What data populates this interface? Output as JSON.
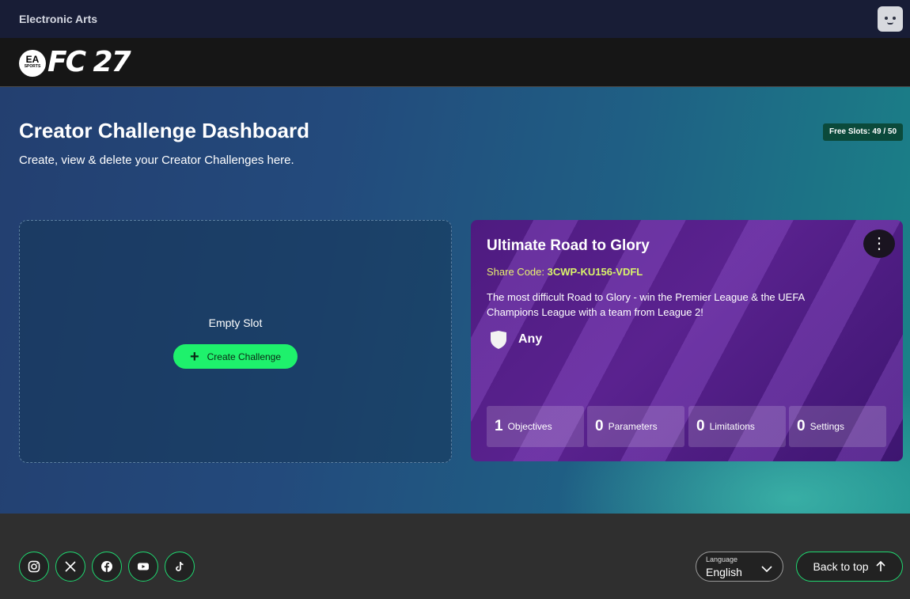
{
  "topbar": {
    "brand": "Electronic Arts"
  },
  "logo": {
    "badge_top": "EA",
    "badge_bottom": "SPORTS",
    "game": "FC 27"
  },
  "header": {
    "title": "Creator Challenge Dashboard",
    "subtitle": "Create, view & delete your Creator Challenges here.",
    "slots": "Free Slots: 49 / 50"
  },
  "empty_slot": {
    "label": "Empty Slot",
    "create_label": "Create Challenge"
  },
  "challenge": {
    "title": "Ultimate Road to Glory",
    "share_label": "Share Code:",
    "share_code": "3CWP-KU156-VDFL",
    "description": "The most difficult Road to Glory - win the Premier League & the UEFA Champions League with a team from League 2!",
    "team": "Any",
    "stats": [
      {
        "count": "1",
        "label": "Objectives"
      },
      {
        "count": "0",
        "label": "Parameters"
      },
      {
        "count": "0",
        "label": "Limitations"
      },
      {
        "count": "0",
        "label": "Settings"
      }
    ]
  },
  "footer": {
    "social": [
      "instagram-icon",
      "x-icon",
      "facebook-icon",
      "youtube-icon",
      "tiktok-icon"
    ],
    "language_caption": "Language",
    "language_value": "English",
    "back_to_top": "Back to top"
  },
  "colors": {
    "accent": "#1ef16c",
    "card": "#5a228f",
    "share_code": "#d9f36a"
  }
}
